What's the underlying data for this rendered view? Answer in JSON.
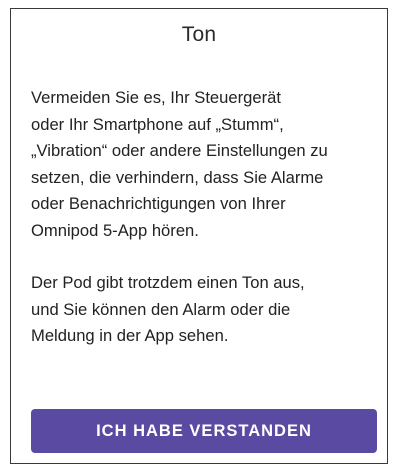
{
  "dialog": {
    "title": "Ton",
    "body_lines_1": [
      "Vermeiden Sie es, Ihr Steuergerät",
      "oder Ihr Smartphone auf „Stumm“,",
      "„Vibration“ oder andere Einstellungen zu",
      "setzen, die verhindern, dass Sie Alarme",
      "oder Benachrichtigungen von Ihrer",
      "Omnipod 5-App hören."
    ],
    "body_lines_2": [
      "Der Pod gibt trotzdem einen Ton aus,",
      "und Sie können den Alarm oder die",
      "Meldung in der App sehen."
    ],
    "confirm_label": "ICH HABE VERSTANDEN"
  },
  "colors": {
    "button_background": "#5b4aa1",
    "button_text": "#ffffff",
    "border": "#3a3a3a",
    "text": "#222222"
  }
}
